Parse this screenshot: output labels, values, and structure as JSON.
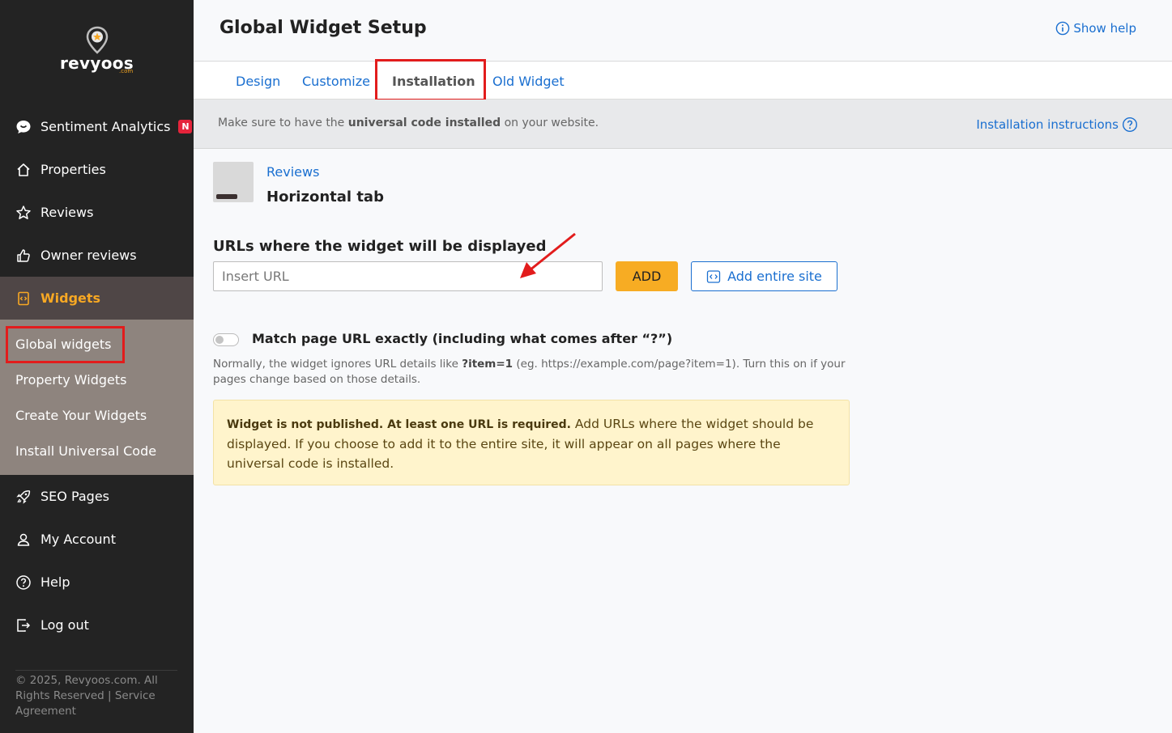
{
  "sidebar": {
    "logo_text": "revyoos",
    "logo_sub": ".com",
    "items": [
      {
        "label": "Sentiment Analytics",
        "badge": "N"
      },
      {
        "label": "Properties"
      },
      {
        "label": "Reviews"
      },
      {
        "label": "Owner reviews"
      },
      {
        "label": "Widgets"
      },
      {
        "label": "SEO Pages"
      },
      {
        "label": "My Account"
      },
      {
        "label": "Help"
      },
      {
        "label": "Log out"
      }
    ],
    "submenu": [
      {
        "label": "Global widgets"
      },
      {
        "label": "Property Widgets"
      },
      {
        "label": "Create Your Widgets"
      },
      {
        "label": "Install Universal Code"
      }
    ],
    "copyright": "© 2025, Revyoos.com. All Rights Reserved | Service Agreement"
  },
  "header": {
    "title": "Global Widget Setup",
    "help_link": "Show help"
  },
  "tabs": [
    {
      "label": "Design"
    },
    {
      "label": "Customize"
    },
    {
      "label": "Installation",
      "active": true
    },
    {
      "label": "Old Widget"
    }
  ],
  "notice": {
    "prefix": "Make sure to have the ",
    "bold": "universal code installed",
    "suffix": " on your website.",
    "link": "Installation instructions"
  },
  "widget": {
    "category": "Reviews",
    "name": "Horizontal tab"
  },
  "urls": {
    "label": "URLs where the widget will be displayed",
    "placeholder": "Insert URL",
    "value": "",
    "add_label": "ADD",
    "add_site_label": "Add entire site"
  },
  "match": {
    "label": "Match page URL exactly (including what comes after “?”)",
    "enabled": false,
    "help_prefix": "Normally, the widget ignores URL details like ",
    "help_bold": "?item=1",
    "help_suffix": " (eg. https://example.com/page?item=1). Turn this on if your pages change based on those details."
  },
  "warning": {
    "bold": "Widget is not published. At least one URL is required.",
    "text": " Add URLs where the widget should be displayed. If you choose to add it to the entire site, it will appear on all pages where the universal code is installed."
  },
  "colors": {
    "sidebar_bg": "#232323",
    "accent": "#f7a823",
    "link": "#1a6fd0",
    "highlight": "#e21c1c",
    "warning_bg": "#fff4cc"
  }
}
